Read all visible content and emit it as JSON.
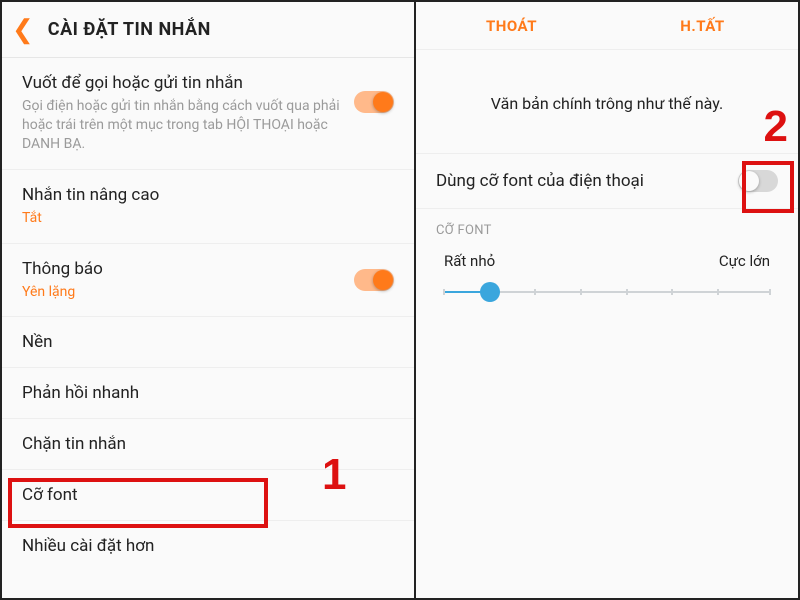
{
  "left": {
    "title": "CÀI ĐẶT TIN NHẮN",
    "items": {
      "swipe": {
        "title": "Vuốt để gọi hoặc gửi tin nhắn",
        "sub": "Gọi điện hoặc gửi tin nhắn bằng cách vuốt qua phải hoặc trái trên một mục trong tab HỘI THOẠI hoặc DANH BẠ.",
        "toggle": true
      },
      "advanced": {
        "title": "Nhắn tin nâng cao",
        "sub": "Tắt"
      },
      "notify": {
        "title": "Thông báo",
        "sub": "Yên lặng",
        "toggle": true
      },
      "background": {
        "title": "Nền"
      },
      "quickreply": {
        "title": "Phản hồi nhanh"
      },
      "block": {
        "title": "Chặn tin nhắn"
      },
      "fontsize": {
        "title": "Cỡ font"
      },
      "more": {
        "title": "Nhiều cài đặt hơn"
      }
    },
    "annotation": "1"
  },
  "right": {
    "exit": "THOÁT",
    "done": "H.TẤT",
    "preview": "Văn bản chính trông như thế này.",
    "usePhoneFont": {
      "label": "Dùng cỡ font của điện thoại",
      "toggle": false
    },
    "sectionLabel": "CỠ FONT",
    "sliderMin": "Rất nhỏ",
    "sliderMax": "Cực lớn",
    "annotation": "2"
  }
}
